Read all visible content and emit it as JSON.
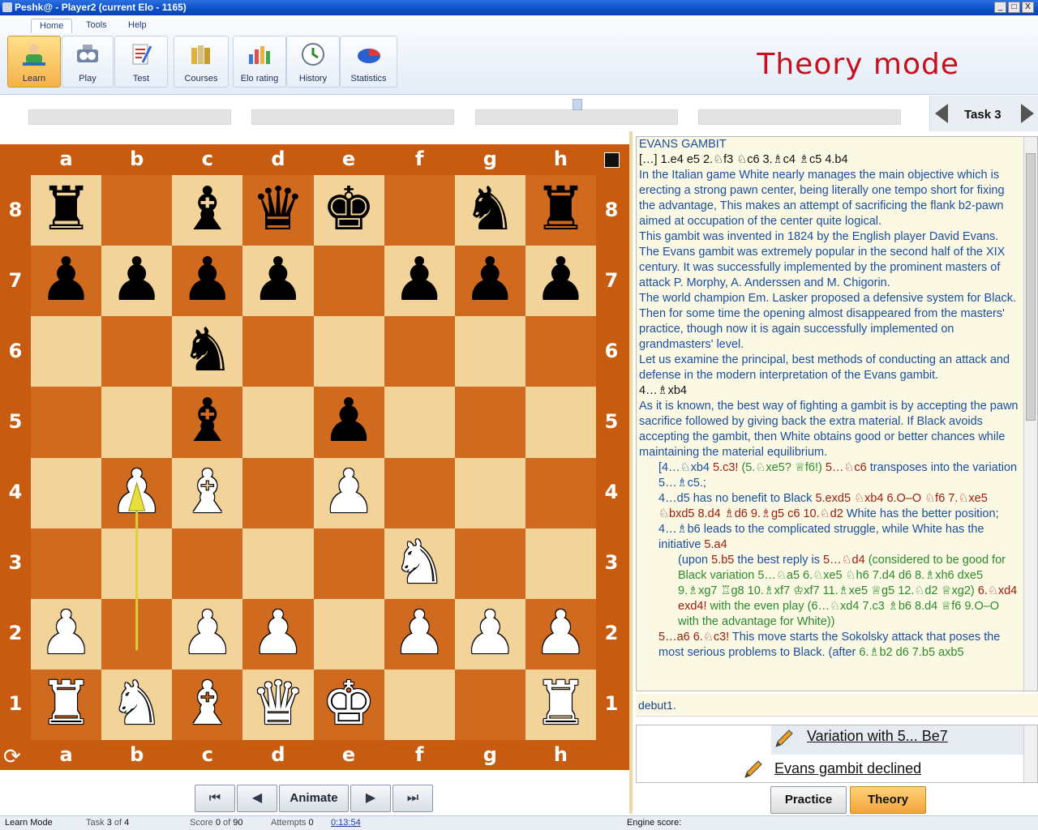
{
  "window": {
    "title": "Peshk@ - Player2 (current Elo - 1165)",
    "min": "_",
    "max": "□",
    "close": "X"
  },
  "ribbon": {
    "tabs": [
      "Home",
      "Tools",
      "Help"
    ],
    "buttons": [
      {
        "label": "Learn",
        "icon": "learn-icon"
      },
      {
        "label": "Play",
        "icon": "play-icon"
      },
      {
        "label": "Test",
        "icon": "test-icon"
      },
      {
        "label": "Courses",
        "icon": "courses-icon"
      },
      {
        "label": "Elo rating",
        "icon": "elo-rating-icon"
      },
      {
        "label": "History",
        "icon": "history-icon"
      },
      {
        "label": "Statistics",
        "icon": "statistics-icon"
      }
    ],
    "mode_title": "Theory mode"
  },
  "task_nav": {
    "label": "Task  3"
  },
  "board": {
    "files": [
      "a",
      "b",
      "c",
      "d",
      "e",
      "f",
      "g",
      "h"
    ],
    "ranks": [
      "8",
      "7",
      "6",
      "5",
      "4",
      "3",
      "2",
      "1"
    ],
    "position": [
      [
        "r",
        "",
        "b",
        "q",
        "k",
        "",
        "n",
        "r"
      ],
      [
        "p",
        "p",
        "p",
        "p",
        "",
        "p",
        "p",
        "p"
      ],
      [
        "",
        "",
        "n",
        "",
        "",
        "",
        "",
        ""
      ],
      [
        "",
        "",
        "b",
        "",
        "p",
        "",
        "",
        ""
      ],
      [
        "",
        "P",
        "B",
        "",
        "P",
        "",
        "",
        ""
      ],
      [
        "",
        "",
        "",
        "",
        "",
        "N",
        "",
        ""
      ],
      [
        "P",
        "",
        "P",
        "P",
        "",
        "P",
        "P",
        "P"
      ],
      [
        "R",
        "N",
        "B",
        "Q",
        "K",
        "",
        "",
        "R"
      ]
    ],
    "arrow": {
      "from": "b2",
      "to": "b4"
    }
  },
  "nav": {
    "first": "⏮",
    "prev": "◀",
    "animate": "Animate",
    "next": "▶",
    "last": "⏭"
  },
  "comment": {
    "heading": "EVANS GAMBIT",
    "moves": "[…] 1.e4 e5 2.♘f3 ♘c6 3.♗c4 ♗c5 4.b4",
    "p1": " In the Italian game White nearly manages the main objective which is erecting a strong pawn center, being literally one tempo short for fixing the advantage, This makes an attempt of sacrificing the flank b2-pawn aimed at occupation of the center quite logical.",
    "p2": " This gambit was invented in 1824 by the English player David Evans.",
    "p3": " The Evans gambit was extremely popular in the second half of the XIX century. It was successfully implemented by the prominent masters of attack P. Morphy, A. Anderssen and M. Chigorin.",
    "p4": " The world champion Em. Lasker proposed a defensive system for Black.",
    "p5": " Then for some time the opening almost disappeared from the masters' practice, though now it is again successfully implemented on grandmasters' level.",
    "p6": " Let us examine the principal, best methods of conducting an attack and defense in the modern interpretation of the Evans gambit.",
    "m2": "4…♗xb4",
    "p7": " As it is known, the best way of fighting a gambit is by accepting the pawn sacrifice followed by giving back the extra material. If Black avoids accepting the gambit, then White obtains good or better chances while maintaining the material equilibrium.",
    "v1a": "[4…♘xb4 ",
    "v1b": "5.c3! ",
    "v1c": "(5.♘xe5? ♕f6!) ",
    "v1d": "5…♘c6 ",
    "v1e": "transposes into the variation 5…♗c5.;",
    "v2a": "4…d5 has no benefit to Black ",
    "v2b": "5.exd5 ♘xb4 6.O–O ♘f6 7.♘xe5 ♘bxd5 8.d4 ♗d6 9.♗g5 c6 10.♘d2",
    "v2c": " White has the better position;",
    "v3a": "4…♗b6 leads to the complicated struggle, while White has the initiative ",
    "v3b": "5.a4",
    "v4a": "(upon ",
    "v4b": "5.b5",
    "v4c": " the best reply is ",
    "v4d": "5…♘d4",
    "v4e": " (considered to be good for Black variation 5…♘a5 6.♘xe5 ♘h6 7.d4 d6 8.♗xh6 dxe5 9.♗xg7 ♖g8 10.♗xf7 ♔xf7 11.♗xe5 ♕g5 12.♘d2 ♕xg2) ",
    "v4f": "6.♘xd4 exd4!",
    "v4g": " with the even play (6…♘xd4 7.c3 ♗b6 8.d4 ♕f6 9.O–O with the advantage for White))",
    "v5a": "5…a6 6.♘c3!",
    "v5b": " This move starts the Sokolsky attack that poses the most serious problems to Black. (after ",
    "v5c": "6.♗b2 d6 7.b5 axb5"
  },
  "debut": "debut1.",
  "tree": {
    "item1": "Variation with 5... Be7",
    "item2": "Evans gambit declined"
  },
  "buttons": {
    "practice": "Practice",
    "theory": "Theory"
  },
  "status": {
    "mode": "Learn Mode",
    "task_label": "Task",
    "task": "3",
    "task_of": "of",
    "task_total": "4",
    "score_label": "Score",
    "score": "0",
    "score_of": "of",
    "score_total": "90",
    "attempts_label": "Attempts",
    "attempts": "0",
    "time": "0:13:54",
    "engine": "Engine score:"
  },
  "colors": {
    "board_frame": "#c75c10",
    "light_square": "#f2d39a",
    "dark_square": "#cf6a1e",
    "accent_title": "#c8101c"
  }
}
